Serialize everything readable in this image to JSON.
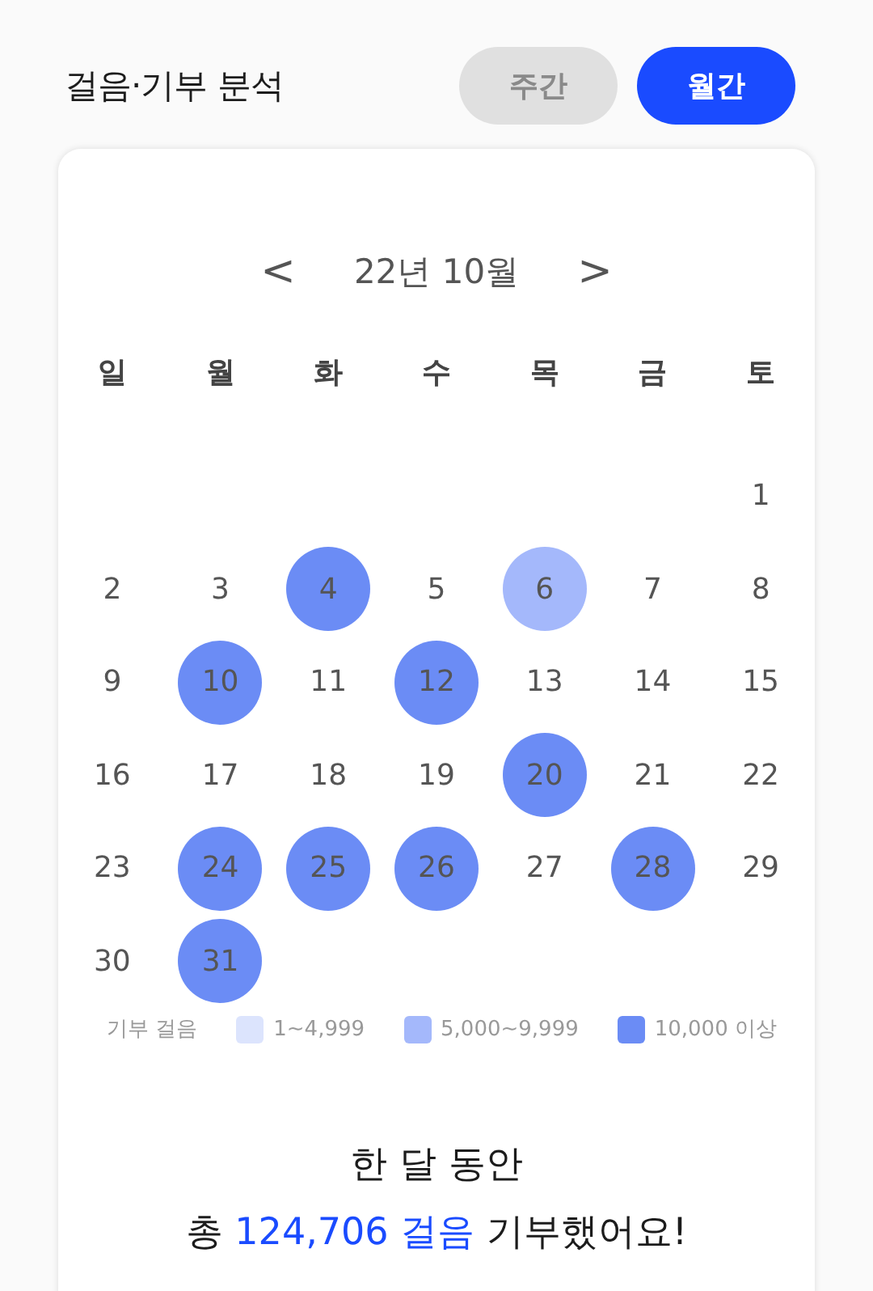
{
  "header": {
    "title": "걸음·기부 분석",
    "tabs": [
      {
        "label": "주간",
        "selected": false
      },
      {
        "label": "월간",
        "selected": true
      }
    ]
  },
  "calendar": {
    "month": "22년 10월",
    "prev": "<",
    "next": ">",
    "weekdays": [
      "일",
      "월",
      "화",
      "수",
      "목",
      "금",
      "토"
    ],
    "weeks": [
      {
        "kind": "first",
        "days": [
          {
            "day": "1"
          }
        ]
      },
      {
        "kind": "week",
        "days": [
          {
            "day": "2"
          },
          {
            "day": "3"
          },
          {
            "day": "4",
            "color": "#6b8cf5"
          },
          {
            "day": "5"
          },
          {
            "day": "6",
            "color": "#a4b8fb"
          },
          {
            "day": "7"
          },
          {
            "day": "8"
          }
        ]
      },
      {
        "kind": "week",
        "days": [
          {
            "day": "9"
          },
          {
            "day": "10",
            "color": "#6b8cf5"
          },
          {
            "day": "11"
          },
          {
            "day": "12",
            "color": "#6b8cf5"
          },
          {
            "day": "13"
          },
          {
            "day": "14"
          },
          {
            "day": "15"
          }
        ]
      },
      {
        "kind": "week",
        "days": [
          {
            "day": "16"
          },
          {
            "day": "17"
          },
          {
            "day": "18"
          },
          {
            "day": "19"
          },
          {
            "day": "20",
            "color": "#6b8cf5"
          },
          {
            "day": "21"
          },
          {
            "day": "22"
          }
        ]
      },
      {
        "kind": "week",
        "days": [
          {
            "day": "23"
          },
          {
            "day": "24",
            "color": "#6b8cf5"
          },
          {
            "day": "25",
            "color": "#6b8cf5"
          },
          {
            "day": "26",
            "color": "#6b8cf5"
          },
          {
            "day": "27"
          },
          {
            "day": "28",
            "color": "#6b8cf5"
          },
          {
            "day": "29"
          }
        ]
      },
      {
        "kind": "week",
        "days": [
          {
            "day": "30"
          },
          {
            "day": "31",
            "color": "#6b8cf5"
          }
        ]
      }
    ]
  },
  "legend": {
    "title": "기부 걸음",
    "items": [
      {
        "label": "1~4,999",
        "color": "#dce4fd"
      },
      {
        "label": "5,000~9,999",
        "color": "#a4b8fb"
      },
      {
        "label": "10,000 이상",
        "color": "#6b8cf5"
      }
    ]
  },
  "summary": {
    "line1": "한 달 동안",
    "prefix": "총",
    "highlight": "124,706 걸음",
    "suffix": "기부했어요!"
  }
}
